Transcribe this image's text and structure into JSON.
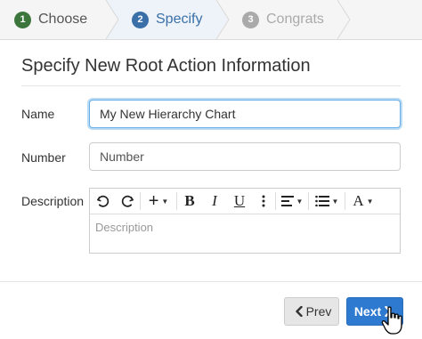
{
  "steps": [
    {
      "number": "1",
      "label": "Choose",
      "state": "done"
    },
    {
      "number": "2",
      "label": "Specify",
      "state": "active"
    },
    {
      "number": "3",
      "label": "Congrats",
      "state": "pending"
    }
  ],
  "heading": "Specify New Root Action Information",
  "form": {
    "name_label": "Name",
    "name_value": "My New Hierarchy Chart",
    "number_label": "Number",
    "number_placeholder": "Number",
    "description_label": "Description",
    "description_placeholder": "Description"
  },
  "toolbar": {
    "undo_icon": "undo-icon",
    "redo_icon": "redo-icon",
    "insert_label": "+",
    "bold_label": "B",
    "italic_label": "I",
    "underline_label": "U",
    "more_icon": "more-vertical-icon",
    "align_icon": "align-left-icon",
    "list_icon": "list-icon",
    "font_label": "A"
  },
  "buttons": {
    "prev_label": "Prev",
    "next_label": "Next"
  },
  "colors": {
    "primary": "#2f7ad1",
    "step_done": "#3c763d",
    "step_active": "#3a6fa8",
    "step_pending": "#aaaaaa"
  }
}
